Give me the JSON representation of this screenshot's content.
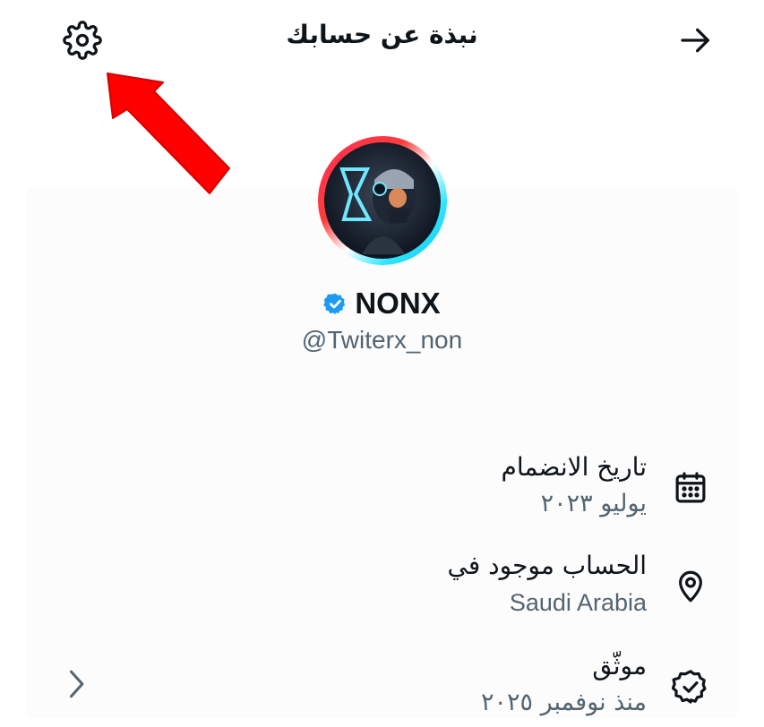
{
  "header": {
    "title": "نبذة عن حسابك",
    "settings_icon": "gear-icon",
    "back_icon": "arrow-right-icon"
  },
  "annotation": {
    "icon": "red-arrow-pointer",
    "color": "#ff0000"
  },
  "profile": {
    "display_name": "NONX",
    "handle": "@Twiterx_non",
    "verified": true,
    "verified_color": "#1d9bf0"
  },
  "details": [
    {
      "icon": "calendar-icon",
      "label": "تاريخ الانضمام",
      "value": "يوليو ٢٠٢٣"
    },
    {
      "icon": "location-pin-icon",
      "label": "الحساب موجود في",
      "value": "Saudi Arabia"
    },
    {
      "icon": "verified-check-icon",
      "label": "موثّق",
      "value": "منذ نوفمبر ٢٠٢٥"
    }
  ],
  "footer": {
    "chevron_icon": "chevron-right-icon"
  },
  "colors": {
    "text": "#0f1419",
    "secondary": "#536471",
    "accent": "#1d9bf0"
  }
}
